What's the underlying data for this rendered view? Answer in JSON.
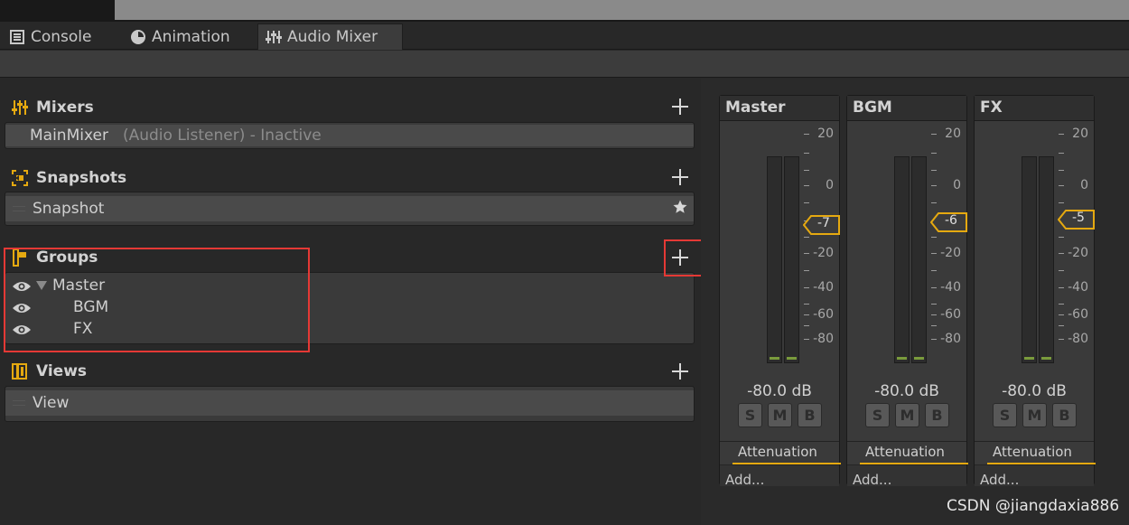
{
  "tabs": [
    {
      "label": "Console",
      "icon": "console-icon"
    },
    {
      "label": "Animation",
      "icon": "animation-clock-icon"
    },
    {
      "label": "Audio Mixer",
      "icon": "audio-mixer-icon"
    }
  ],
  "sections": {
    "mixers": {
      "title": "Mixers",
      "icon": "mixers-icon",
      "item_name": "MainMixer",
      "item_status": "(Audio Listener) - Inactive"
    },
    "snapshots": {
      "title": "Snapshots",
      "icon": "snapshot-icon",
      "item": "Snapshot"
    },
    "groups": {
      "title": "Groups",
      "icon": "groups-icon",
      "items": [
        "Master",
        "BGM",
        "FX"
      ]
    },
    "views": {
      "title": "Views",
      "icon": "views-icon",
      "item": "View"
    }
  },
  "strips": [
    {
      "name": "Master",
      "fader": "-7",
      "level": "-80.0 dB",
      "effect": "Attenuation",
      "add": "Add..."
    },
    {
      "name": "BGM",
      "fader": "-6",
      "level": "-80.0 dB",
      "effect": "Attenuation",
      "add": "Add..."
    },
    {
      "name": "FX",
      "fader": "-5",
      "level": "-80.0 dB",
      "effect": "Attenuation",
      "add": "Add..."
    }
  ],
  "scale_labels": [
    "20",
    "0",
    "-20",
    "-40",
    "-60",
    "-80"
  ],
  "buttons": {
    "solo": "S",
    "mute": "M",
    "bypass": "B"
  },
  "watermark": "CSDN @jiangdaxia886",
  "colors": {
    "accent": "#e5a910",
    "highlight_box": "#e53935",
    "meter_green": "#7a9b3c"
  }
}
